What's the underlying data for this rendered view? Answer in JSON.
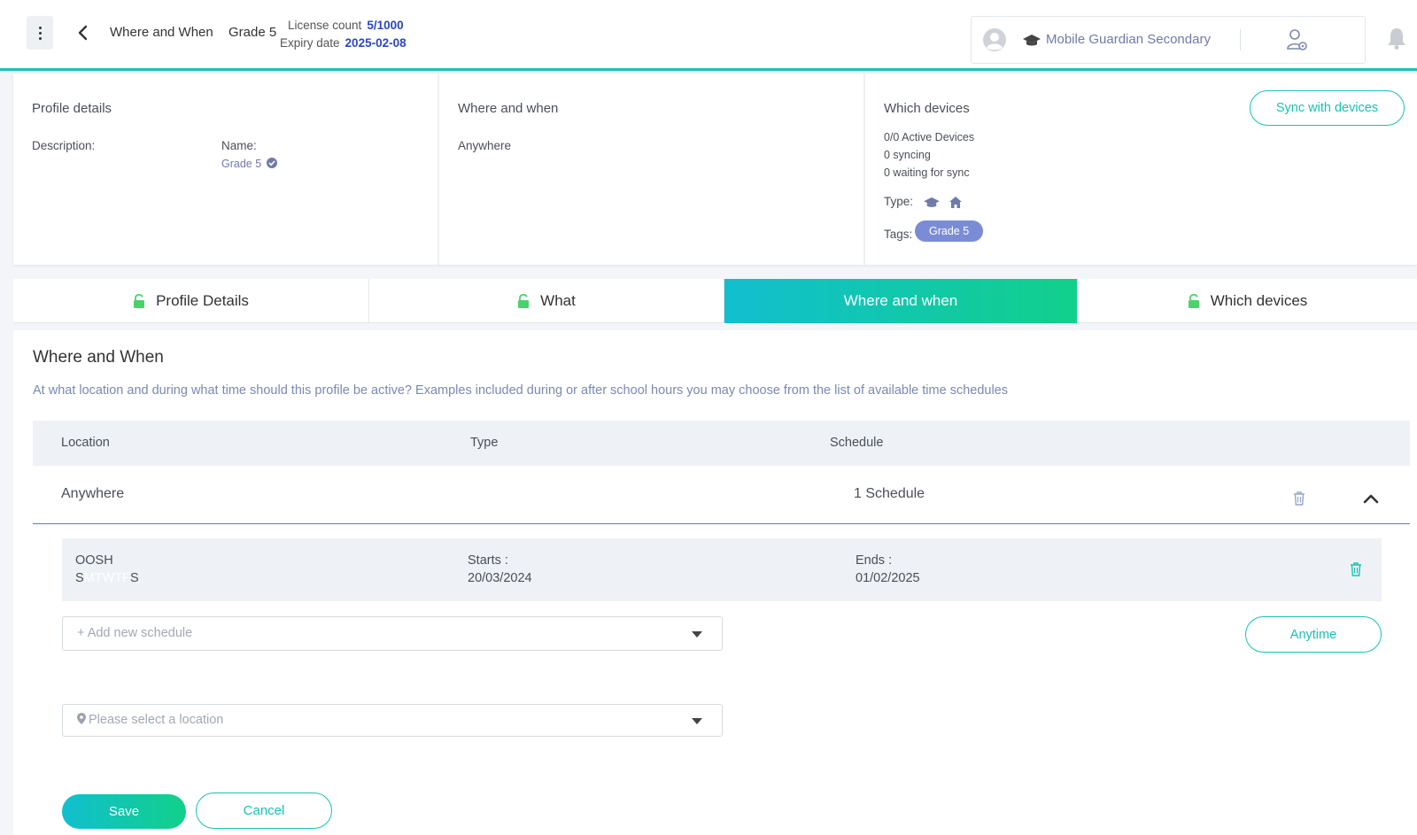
{
  "header": {
    "breadcrumb_page": "Where and When",
    "breadcrumb_profile": "Grade 5",
    "license_count_label": "License count",
    "license_count_value": "5/1000",
    "expiry_label": "Expiry date",
    "expiry_value": "2025-02-08",
    "school_name": "Mobile Guardian Secondary"
  },
  "summary": {
    "profile": {
      "title": "Profile details",
      "description_label": "Description:",
      "name_label": "Name:",
      "name_value": "Grade 5"
    },
    "where": {
      "title": "Where and when",
      "value": "Anywhere"
    },
    "devices": {
      "title": "Which devices",
      "active": "0/0 Active Devices",
      "syncing": "0 syncing",
      "waiting": "0 waiting for sync",
      "type_label": "Type:",
      "tags_label": "Tags:",
      "tag": "Grade 5",
      "sync_button": "Sync with devices"
    }
  },
  "tabs": [
    {
      "label": "Profile Details"
    },
    {
      "label": "What"
    },
    {
      "label": "Where and when"
    },
    {
      "label": "Which devices"
    }
  ],
  "panel": {
    "title": "Where and When",
    "description": "At what location and during what time should this profile be active? Examples included during or after school hours you may choose from the list of available time schedules",
    "columns": {
      "location": "Location",
      "type": "Type",
      "schedule": "Schedule"
    },
    "row": {
      "location": "Anywhere",
      "schedule": "1 Schedule"
    },
    "schedule_item": {
      "name": "OOSH",
      "days": [
        "S",
        "M",
        "T",
        "W",
        "T",
        "F",
        "S"
      ],
      "starts_label": "Starts :",
      "starts_value": "20/03/2024",
      "ends_label": "Ends :",
      "ends_value": "01/02/2025"
    },
    "add_schedule_placeholder": "+ Add new schedule",
    "anytime_button": "Anytime",
    "location_placeholder": "Please select a location",
    "save_button": "Save",
    "cancel_button": "Cancel"
  },
  "colors": {
    "accent": "#17c3b2",
    "link": "#2b45c7",
    "tag": "#7b8cd6"
  }
}
